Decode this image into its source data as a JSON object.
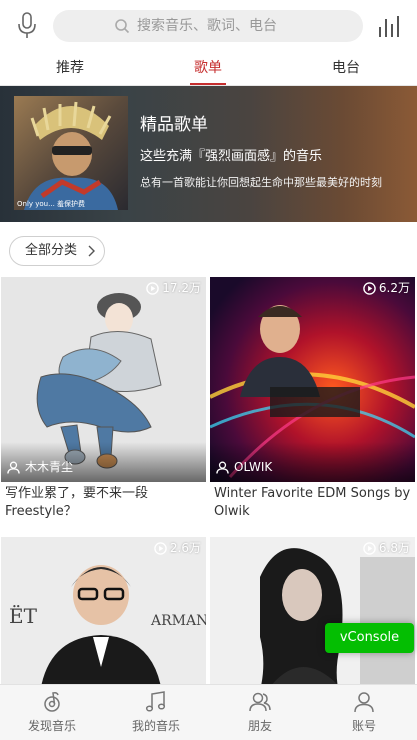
{
  "search": {
    "placeholder": "搜索音乐、歌词、电台"
  },
  "tabs": [
    {
      "label": "推荐"
    },
    {
      "label": "歌单"
    },
    {
      "label": "电台"
    }
  ],
  "tabs_active_index": 1,
  "banner": {
    "title": "精品歌单",
    "subtitle": "这些充满『强烈画面感』的音乐",
    "description": "总有一首歌能让你回想起生命中那些最美好的时刻",
    "cover_caption": "Only you...  羞保护费"
  },
  "category_button": {
    "label": "全部分类"
  },
  "playlists": [
    {
      "play_count": "17.2万",
      "author": "木木青尘",
      "title": "写作业累了，要不来一段Freestyle？",
      "cover_theme": "illustration"
    },
    {
      "play_count": "6.2万",
      "author": "OLWIK",
      "title": "Winter Favorite EDM Songs by Olwik",
      "cover_theme": "dj-lights"
    },
    {
      "play_count": "2.6万",
      "author": "",
      "title": "",
      "cover_theme": "suit-portrait"
    },
    {
      "play_count": "6.8万",
      "author": "",
      "title": "",
      "cover_theme": "bw-portrait"
    }
  ],
  "vconsole": {
    "label": "vConsole"
  },
  "bottom_nav": [
    {
      "label": "发现音乐",
      "icon": "discover-icon"
    },
    {
      "label": "我的音乐",
      "icon": "music-note-icon"
    },
    {
      "label": "朋友",
      "icon": "friends-icon"
    },
    {
      "label": "账号",
      "icon": "account-icon"
    }
  ],
  "colors": {
    "accent": "#c62f2f",
    "vconsole": "#04be02",
    "search_bg": "#eeeeee",
    "nav_bg": "#f6f6f6"
  }
}
